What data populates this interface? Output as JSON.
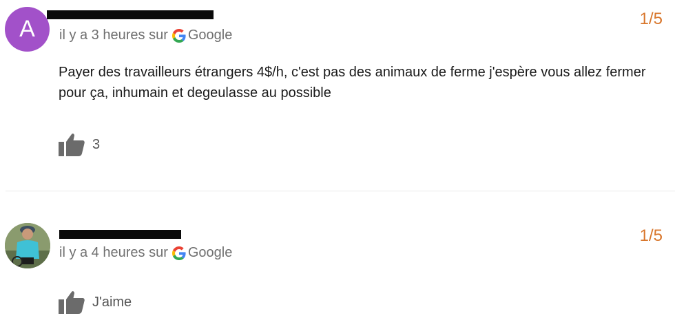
{
  "reviews": [
    {
      "avatar_letter": "A",
      "avatar_color": "#a251c9",
      "time_prefix": "il y a 3 heures sur",
      "source": "Google",
      "rating": "1/5",
      "text": "Payer des travailleurs étrangers 4$/h, c'est pas des animaux de ferme j'espère vous allez fermer pour ça, inhumain et degeulasse au possible",
      "likes": "3"
    },
    {
      "time_prefix": "il y a 4 heures sur",
      "source": "Google",
      "rating": "1/5",
      "like_label": "J'aime"
    }
  ],
  "colors": {
    "rating": "#d8762b",
    "meta_text": "#6f6f6f",
    "redaction": "#0a0a0a"
  },
  "icons": [
    "google-g-icon",
    "thumbs-up-icon"
  ]
}
